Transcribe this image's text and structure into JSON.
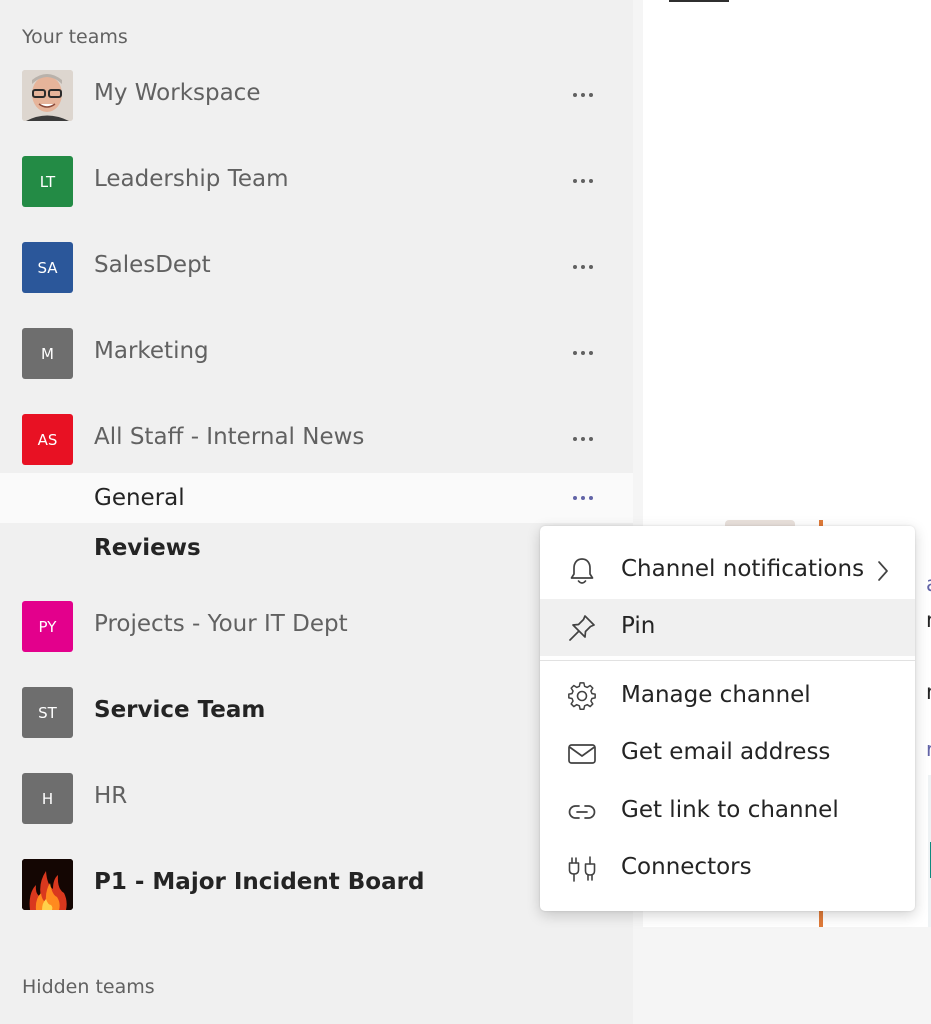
{
  "sections": {
    "your_teams": "Your teams",
    "hidden_teams": "Hidden teams"
  },
  "teams": [
    {
      "name": "My Workspace",
      "initials": "",
      "avatar_color": "#d8d2cc",
      "avatar_kind": "photo-person"
    },
    {
      "name": "Leadership Team",
      "initials": "LT",
      "avatar_color": "#238b45"
    },
    {
      "name": "SalesDept",
      "initials": "SA",
      "avatar_color": "#2b579a"
    },
    {
      "name": "Marketing",
      "initials": "M",
      "avatar_color": "#6e6e6e"
    },
    {
      "name": "All Staff - Internal News",
      "initials": "AS",
      "avatar_color": "#e81123"
    },
    {
      "name": "Projects - Your IT Dept",
      "initials": "PY",
      "avatar_color": "#e3008c"
    },
    {
      "name": "Service Team",
      "initials": "ST",
      "avatar_color": "#6e6e6e"
    },
    {
      "name": "HR",
      "initials": "H",
      "avatar_color": "#6e6e6e"
    },
    {
      "name": "P1 - Major Incident Board",
      "initials": "",
      "avatar_color": "#1a0a05",
      "avatar_kind": "photo-fire"
    }
  ],
  "channels": [
    {
      "name": "General"
    },
    {
      "name": "Reviews"
    }
  ],
  "context_menu": {
    "items": [
      {
        "label": "Channel notifications",
        "icon": "bell-icon"
      },
      {
        "label": "Pin",
        "icon": "pin-icon"
      },
      {
        "label": "Manage channel",
        "icon": "gear-icon"
      },
      {
        "label": "Get email address",
        "icon": "envelope-icon"
      },
      {
        "label": "Get link to channel",
        "icon": "link-icon"
      },
      {
        "label": "Connectors",
        "icon": "connectors-icon"
      }
    ]
  },
  "content_peek": {
    "line1": "ar",
    "line2": "nts",
    "line3": "m",
    "line4": "re"
  },
  "colors": {
    "accent": "#6264a7",
    "sidebar_bg": "#f0f0f0",
    "selected_row_bg": "#fafafa",
    "menu_hover_bg": "#f0f0f0"
  }
}
